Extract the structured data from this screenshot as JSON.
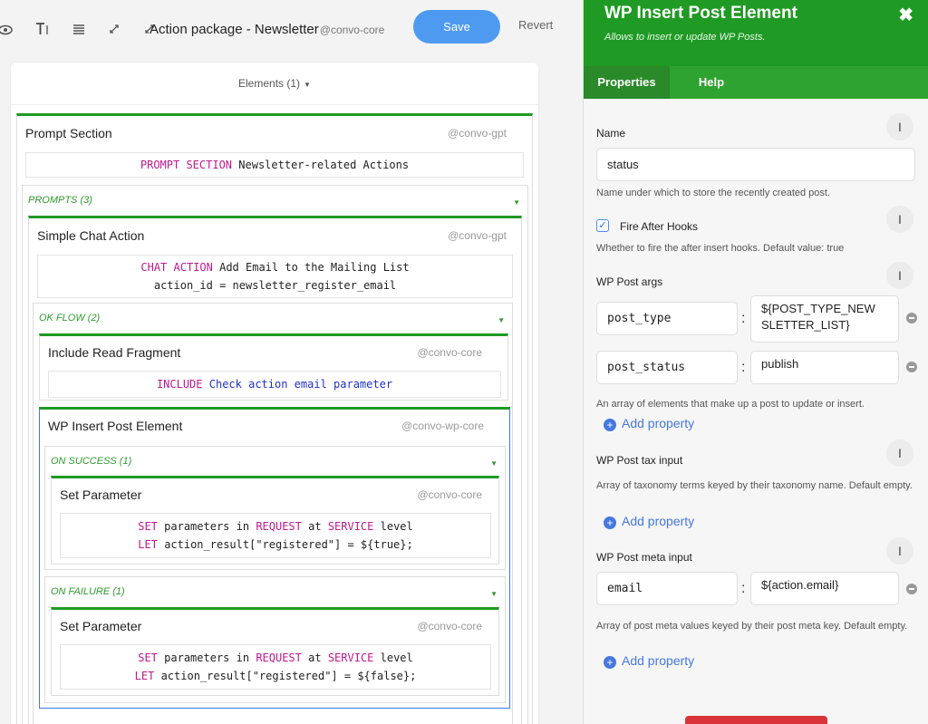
{
  "toolbar": {
    "title": "Action package - Newsletter",
    "context": "@convo-core",
    "save_label": "Save",
    "revert_label": "Revert",
    "icons": [
      "eye-icon",
      "text-format-icon",
      "list-icon",
      "collapse-icon",
      "expand-icon"
    ]
  },
  "canvas": {
    "elements_label": "Elements (1)",
    "prompt_section": {
      "title": "Prompt Section",
      "context": "@convo-gpt",
      "code_kw": "PROMPT SECTION",
      "code_text": "Newsletter-related Actions",
      "prompts_label": "PROMPTS (3)"
    },
    "chat_action": {
      "title": "Simple Chat Action",
      "context": "@convo-gpt",
      "code_kw": "CHAT ACTION",
      "code_text": "Add Email to the Mailing List",
      "code_line2": "action_id = newsletter_register_email",
      "ok_flow_label": "OK FLOW (2)"
    },
    "include": {
      "title": "Include Read Fragment",
      "context": "@convo-core",
      "code_kw": "INCLUDE",
      "code_text": "Check action email parameter"
    },
    "wp_insert": {
      "title": "WP Insert Post Element",
      "context": "@convo-wp-core",
      "on_success_label": "ON SUCCESS (1)",
      "on_failure_label": "ON FAILURE (1)"
    },
    "set_success": {
      "title": "Set Parameter",
      "context": "@convo-core",
      "kw_set": "SET",
      "t1": "parameters in",
      "kw_request": "REQUEST",
      "t2": "at",
      "kw_service": "SERVICE",
      "t3": "level",
      "kw_let": "LET",
      "line2": "action_result[\"registered\"] = ${true};"
    },
    "set_failure": {
      "title": "Set Parameter",
      "context": "@convo-core",
      "kw_set": "SET",
      "t1": "parameters in",
      "kw_request": "REQUEST",
      "t2": "at",
      "kw_service": "SERVICE",
      "t3": "level",
      "kw_let": "LET",
      "line2": "action_result[\"registered\"] = ${false};"
    }
  },
  "panel": {
    "title": "WP Insert Post Element",
    "subtitle": "Allows to insert or update WP Posts.",
    "close_glyph": "✖",
    "tabs": [
      "Properties",
      "Help"
    ],
    "name_label": "Name",
    "name_value": "status",
    "name_help": "Name under which to store the recently created post.",
    "fire_label": "Fire After Hooks",
    "fire_checked": true,
    "fire_help": "Whether to fire the after insert hooks. Default value: true",
    "args_label": "WP Post args",
    "args": [
      {
        "key": "post_type",
        "value": "${POST_TYPE_NEWSLETTER_LIST}",
        "value_l1": "${POST_TYPE_NEW",
        "value_l2": "SLETTER_LIST}"
      },
      {
        "key": "post_status",
        "value": "publish"
      }
    ],
    "args_help": "An array of elements that make up a post to update or insert.",
    "add_property": "Add property",
    "tax_label": "WP Post tax input",
    "tax_help": "Array of taxonomy terms keyed by their taxonomy name. Default empty.",
    "meta_label": "WP Post meta input",
    "meta": [
      {
        "key": "email",
        "value": "${action.email}"
      }
    ],
    "meta_help": "Array of post meta values keyed by their post meta key. Default empty."
  }
}
